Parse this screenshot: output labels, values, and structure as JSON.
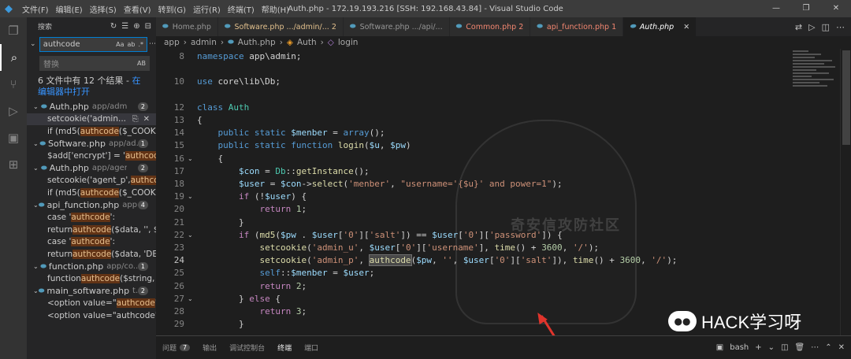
{
  "titlebar": {
    "menu": [
      "文件(F)",
      "编辑(E)",
      "选择(S)",
      "查看(V)",
      "转到(G)",
      "运行(R)",
      "终端(T)",
      "帮助(H)"
    ],
    "title": "Auth.php - 172.19.193.216 [SSH: 192.168.43.84] - Visual Studio Code"
  },
  "sidebar": {
    "header": "搜索",
    "search_value": "authcode",
    "search_opts": [
      "Aa",
      "ab",
      ".*"
    ],
    "replace_placeholder": "替换",
    "replace_opt": "AB",
    "results_text": "6 文件中有 12 个结果 - ",
    "results_link": "在编辑器中打开",
    "groups": [
      {
        "name": "Auth.php",
        "path": "app/admin",
        "count": "2",
        "matches": [
          {
            "pre": "setcookie('admin...",
            "hit": "",
            "post": "",
            "selected": true
          },
          {
            "pre": "if (md5(",
            "hit": "authcode",
            "post": "($_COOKI...",
            "selected": false
          }
        ]
      },
      {
        "name": "Software.php",
        "path": "app/ad...",
        "count": "1",
        "matches": [
          {
            "pre": "$add['encrypt'] = '",
            "hit": "authcode",
            "post": "';",
            "selected": false
          }
        ]
      },
      {
        "name": "Auth.php",
        "path": "app/agent",
        "count": "2",
        "matches": [
          {
            "pre": "setcookie('agent_p', ",
            "hit": "authco",
            "post": "",
            "selected": false
          },
          {
            "pre": "if (md5(",
            "hit": "authcode",
            "post": "($_COOKI...",
            "selected": false
          }
        ]
      },
      {
        "name": "api_function.php",
        "path": "app...",
        "count": "4",
        "matches": [
          {
            "pre": "case '",
            "hit": "authcode",
            "post": "':",
            "selected": false
          },
          {
            "pre": "return ",
            "hit": "authcode",
            "post": "($data, '', $...",
            "selected": false
          },
          {
            "pre": "case '",
            "hit": "authcode",
            "post": "':",
            "selected": false
          },
          {
            "pre": "return ",
            "hit": "authcode",
            "post": "($data, 'DE...",
            "selected": false
          }
        ]
      },
      {
        "name": "function.php",
        "path": "app/co...",
        "count": "1",
        "matches": [
          {
            "pre": "function ",
            "hit": "authcode",
            "post": "($string, ...",
            "selected": false
          }
        ]
      },
      {
        "name": "main_software.php",
        "path": "t...",
        "count": "2",
        "matches": [
          {
            "pre": "<option value=\"",
            "hit": "authcode",
            "post": "\" ...",
            "selected": false
          },
          {
            "pre": "<option value=\"authcode\" ...",
            "hit": "",
            "post": "",
            "selected": false
          }
        ]
      }
    ]
  },
  "tabs": [
    {
      "label": "Home.php",
      "state": "normal"
    },
    {
      "label": "Software.php .../admin/... 2",
      "state": "mod"
    },
    {
      "label": "Software.php .../api/...",
      "state": "normal"
    },
    {
      "label": "Common.php 2",
      "state": "err"
    },
    {
      "label": "api_function.php 1",
      "state": "err"
    },
    {
      "label": "Auth.php",
      "state": "active"
    }
  ],
  "breadcrumb": [
    "app",
    "admin",
    "Auth.php",
    "Auth",
    "login"
  ],
  "code": {
    "lines": [
      "8",
      "9",
      "10",
      "11",
      "12",
      "13",
      "14",
      "15",
      "16",
      "17",
      "18",
      "19",
      "20",
      "21",
      "22",
      "23",
      "24",
      "25",
      "26",
      "27",
      "28",
      "29"
    ],
    "current_line": "24"
  },
  "watermark": "奇安信攻防社区",
  "panel": {
    "tabs": [
      "问题",
      "输出",
      "调试控制台",
      "终端",
      "端口"
    ],
    "problems_badge": "7",
    "active": "终端",
    "terminal_label": "bash"
  },
  "brand": {
    "text": "HACK学习呀"
  }
}
